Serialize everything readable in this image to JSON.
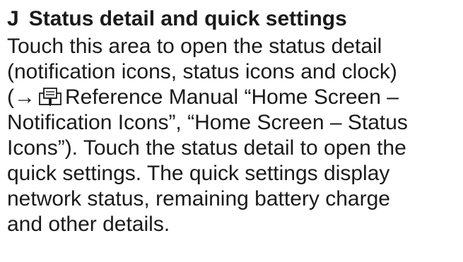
{
  "heading": {
    "letter": "J",
    "title": "Status detail and quick settings"
  },
  "body": {
    "line1": "Touch this area to open the status detail",
    "line2": "(notification icons, status icons and clock)",
    "line3_open": "(",
    "line3_arrow": "→",
    "line3_text": "Reference Manual “Home Screen –",
    "line4": "Notification Icons”, “Home Screen – Status",
    "line5": "Icons”). Touch the status detail to open the",
    "line6": "quick settings. The quick settings display",
    "line7": "network status, remaining battery charge",
    "line8": "and other details."
  },
  "icons": {
    "reference": "manual-book-icon"
  }
}
